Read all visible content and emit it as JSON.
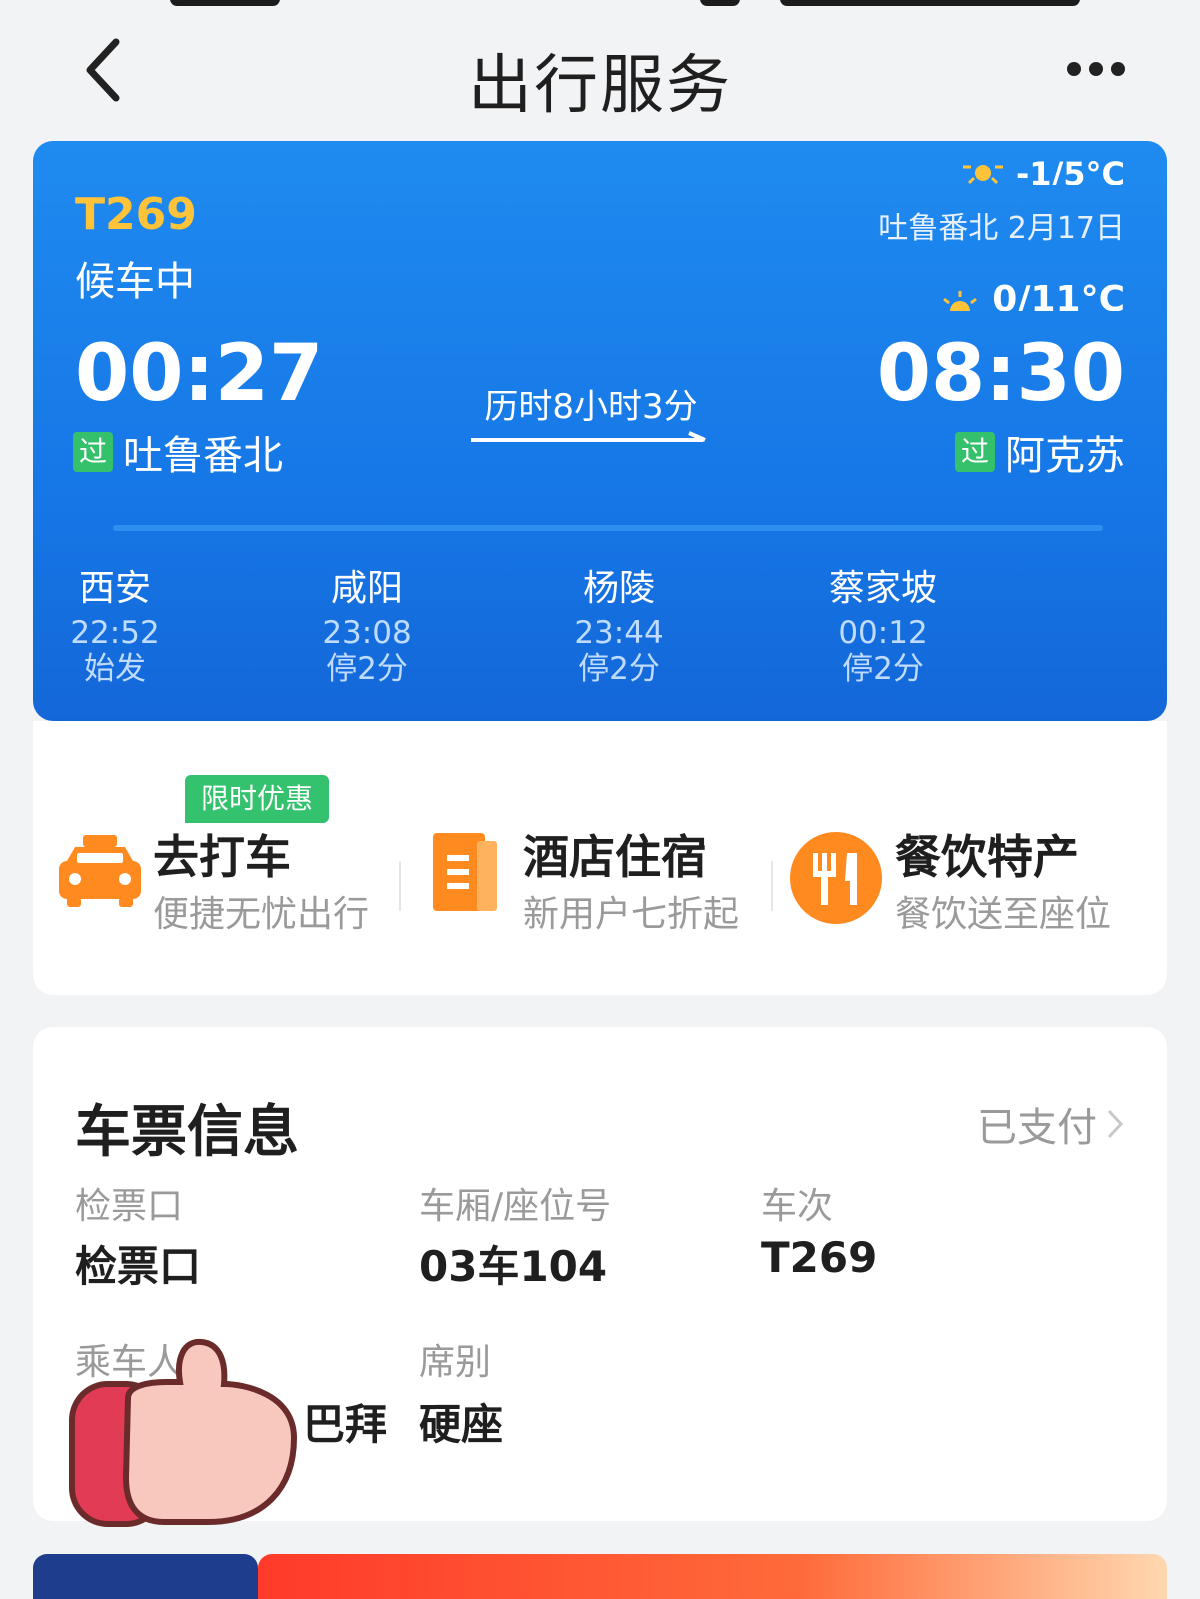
{
  "nav": {
    "title": "出行服务"
  },
  "train": {
    "number": "T269",
    "status": "候车中",
    "weather_top": "-1/5°C",
    "arrival_station_date": "吐鲁番北 2月17日",
    "weather_bottom": "0/11°C",
    "departure_time": "00:27",
    "departure_station": "吐鲁番北",
    "arrival_time": "08:30",
    "arrival_station": "阿克苏",
    "pass_badge": "过",
    "duration": "历时8小时3分",
    "stops": [
      {
        "name": "西安",
        "time": "22:52",
        "note": "始发"
      },
      {
        "name": "咸阳",
        "time": "23:08",
        "note": "停2分"
      },
      {
        "name": "杨陵",
        "time": "23:44",
        "note": "停2分"
      },
      {
        "name": "蔡家坡",
        "time": "00:12",
        "note": "停2分"
      }
    ],
    "colors": {
      "card": "#1677e6",
      "train_number": "#ffc33a",
      "pass_badge": "#35c06b"
    }
  },
  "services": {
    "promo_tag": "限时优惠",
    "items": [
      {
        "title": "去打车",
        "subtitle": "便捷无忧出行",
        "icon": "taxi-icon"
      },
      {
        "title": "酒店住宿",
        "subtitle": "新用户七折起",
        "icon": "hotel-icon"
      },
      {
        "title": "餐饮特产",
        "subtitle": "餐饮送至座位",
        "icon": "dining-icon"
      }
    ],
    "accent": "#ff8a1f"
  },
  "ticket": {
    "title": "车票信息",
    "status": "已支付",
    "check_in_label": "检票口",
    "check_in_value": "检票口",
    "seat_label": "车厢/座位号",
    "seat_value": "03车104",
    "train_label": "车次",
    "train_value": "T269",
    "passenger_label": "乘车人",
    "passenger_value": "巴拜",
    "class_label": "席别",
    "class_value": "硬座"
  }
}
